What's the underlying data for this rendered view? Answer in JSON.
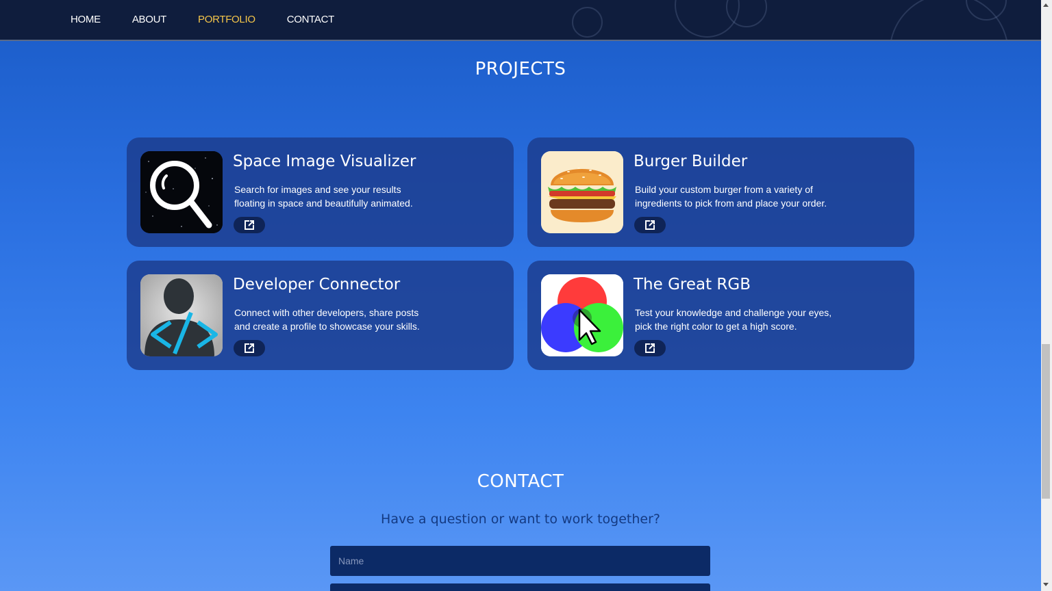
{
  "nav": {
    "items": [
      {
        "label": "HOME"
      },
      {
        "label": "ABOUT"
      },
      {
        "label": "PORTFOLIO"
      },
      {
        "label": "CONTACT"
      }
    ],
    "active": "PORTFOLIO",
    "active_color": "#f5c64a"
  },
  "projects": {
    "title": "PROJECTS",
    "cards": [
      {
        "title": "Space Image Visualizer",
        "desc_line1": "Search for images and see your results",
        "desc_line2": "floating in space and beautifully animated.",
        "icon": "magnifier-space-icon"
      },
      {
        "title": "Burger Builder",
        "desc_line1": "Build your custom burger from a variety of",
        "desc_line2": "ingredients to pick from and place your order.",
        "icon": "burger-icon"
      },
      {
        "title": "Developer Connector",
        "desc_line1": "Connect with other developers, share posts",
        "desc_line2": "and create a profile to showcase your skills.",
        "icon": "developer-code-icon"
      },
      {
        "title": "The Great RGB",
        "desc_line1": "Test your knowledge and challenge your eyes,",
        "desc_line2": "pick the right color to get a high score.",
        "icon": "rgb-circles-icon"
      }
    ]
  },
  "contact": {
    "title": "CONTACT",
    "subtitle": "Have a question or want to work together?",
    "name_placeholder": "Name"
  }
}
